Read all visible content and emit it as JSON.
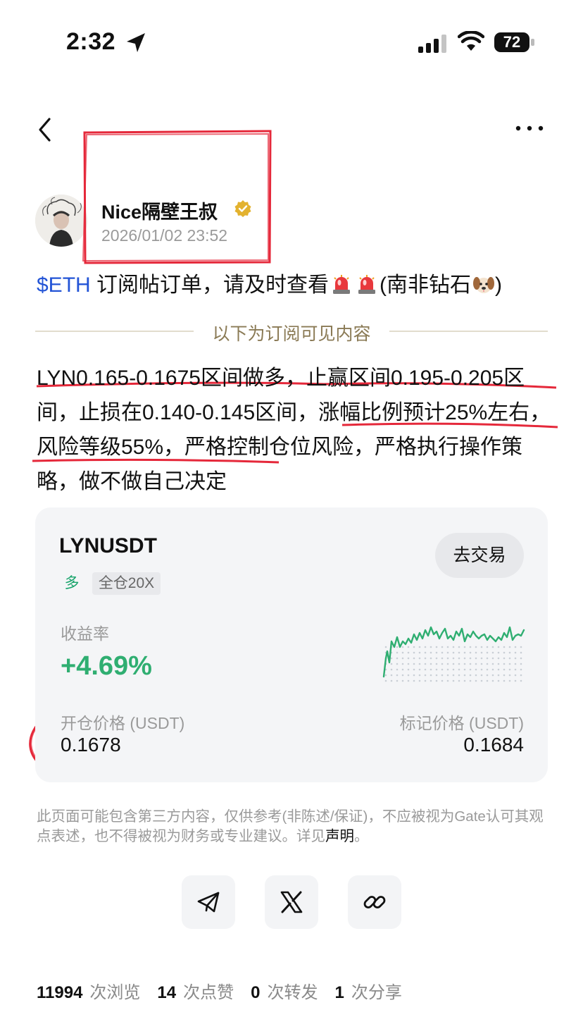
{
  "status_bar": {
    "time": "2:32",
    "battery": "72"
  },
  "post": {
    "author": "Nice隔壁王叔",
    "timestamp": "2026/01/02 23:52",
    "headline_tag": "$ETH",
    "headline_text": "订阅帖订单，请及时查看",
    "headline_suffix_open": "(南非钻石",
    "headline_suffix_close": ")",
    "divider_text": "以下为订阅可见内容",
    "body": "LYN0.165-0.1675区间做多，止赢区间0.195-0.205区间，止损在0.140-0.145区间，涨幅比例预计25%左右，风险等级55%，严格控制仓位风险，严格执行操作策略，做不做自己决定"
  },
  "trade_card": {
    "symbol": "LYNUSDT",
    "side": "多",
    "leverage": "全仓20X",
    "trade_button": "去交易",
    "roi_label": "收益率",
    "roi_value": "+4.69%",
    "entry_price_label": "开仓价格 (USDT)",
    "entry_price": "0.1678",
    "mark_price_label": "标记价格 (USDT)",
    "mark_price": "0.1684",
    "accent_color": "#2fae71"
  },
  "disclaimer": {
    "text": "此页面可能包含第三方内容，仅供参考(非陈述/保证)，不应被视为Gate认可其观点表述，也不得被视为财务或专业建议。详见",
    "link": "声明",
    "end": "。"
  },
  "share": {
    "icons": [
      "telegram-icon",
      "x-icon",
      "link-icon"
    ]
  },
  "stats": {
    "views": "11994",
    "views_label": "次浏览",
    "likes": "14",
    "likes_label": "次点赞",
    "reposts": "0",
    "reposts_label": "次转发",
    "shares": "1",
    "shares_label": "次分享"
  }
}
